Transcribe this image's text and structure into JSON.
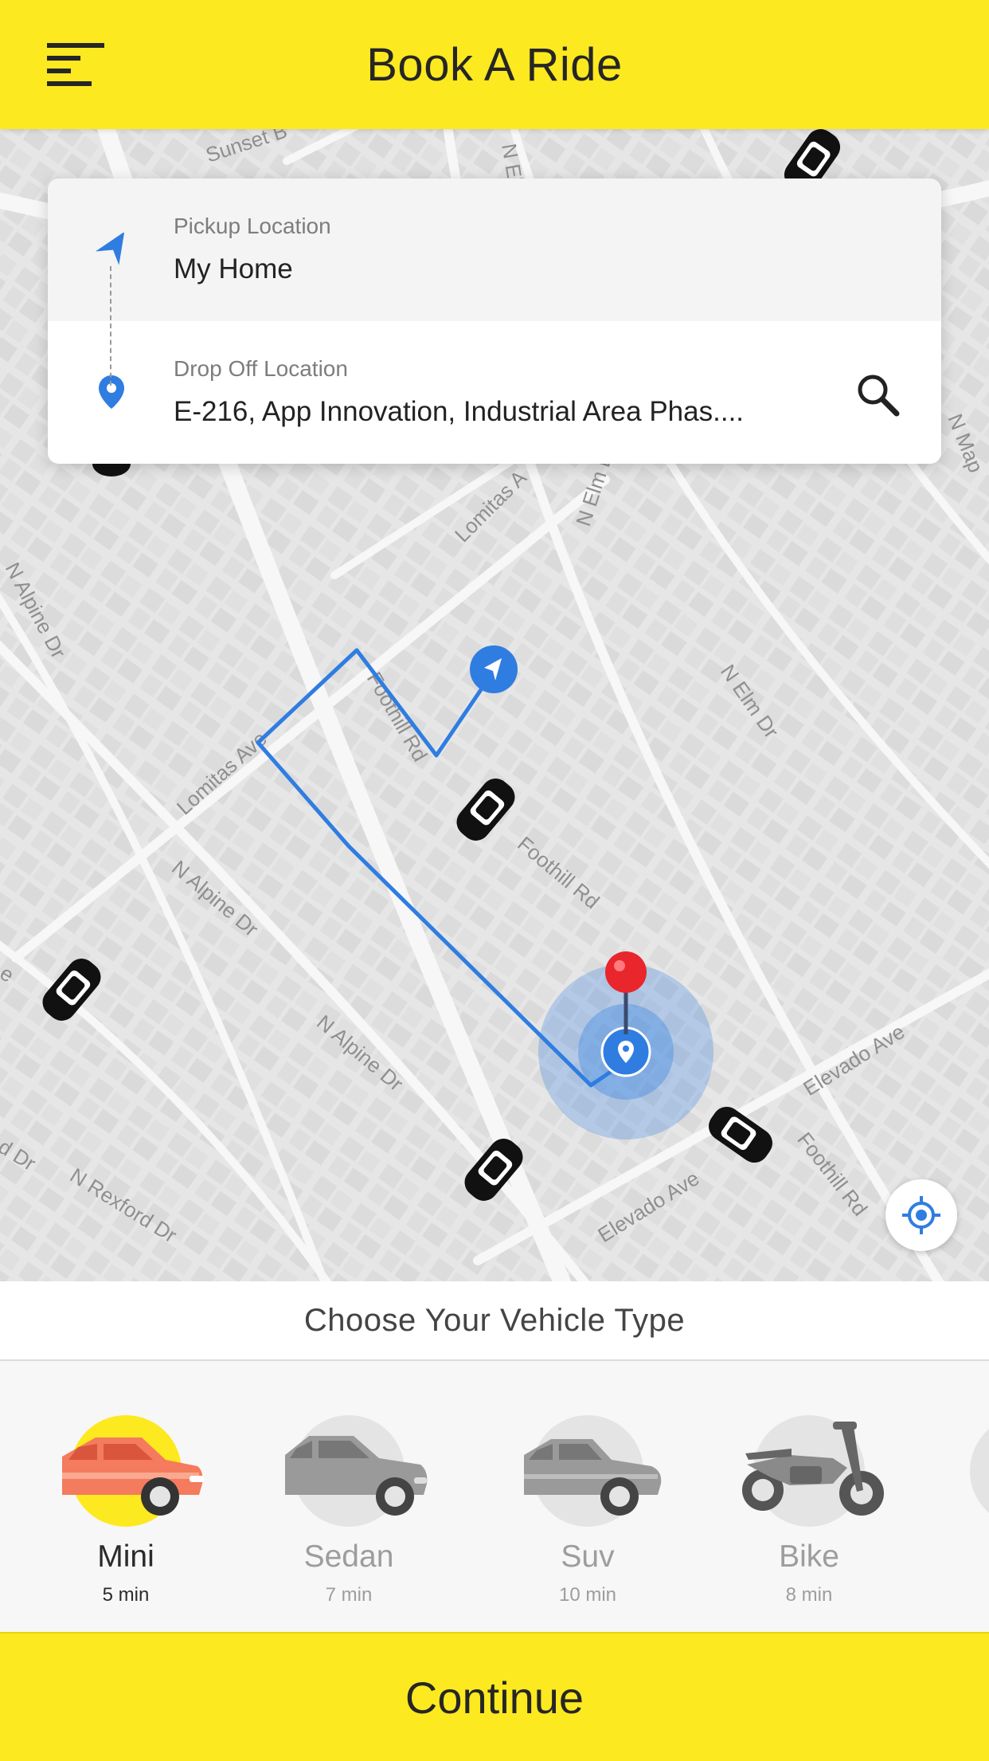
{
  "header": {
    "title": "Book A Ride",
    "menu_icon": "menu-icon"
  },
  "map": {
    "street_labels": [
      "Sunset B",
      "N Elm",
      "Lomitas A",
      "N Elm Dr",
      "N Map",
      "N Alpine Dr",
      "Lomitas Ave",
      "Foothill Rd",
      "N Elm Dr",
      "N Alpine Dr",
      "Foothill Rd",
      "N Alpine Dr",
      "Elevado Ave",
      "Elevado Ave",
      "Foothill Rd",
      "N Rexford Dr",
      "d Dr",
      "e"
    ],
    "route_color": "#2f7de1",
    "destination_pin_color": "#e8262c"
  },
  "location_card": {
    "pickup": {
      "label": "Pickup Location",
      "value": "My Home",
      "icon": "navigation-arrow-icon"
    },
    "dropoff": {
      "label": "Drop Off Location",
      "value": "E-216, App Innovation, Industrial Area Phas....",
      "icon": "location-pin-icon"
    },
    "search_icon": "search-icon"
  },
  "locate_icon": "crosshair-icon",
  "vehicle_section": {
    "title": "Choose Your Vehicle Type",
    "vehicles": [
      {
        "name": "Mini",
        "eta": "5 min",
        "selected": true,
        "icon": "mini-car-icon"
      },
      {
        "name": "Sedan",
        "eta": "7 min",
        "selected": false,
        "icon": "sedan-car-icon"
      },
      {
        "name": "Suv",
        "eta": "10 min",
        "selected": false,
        "icon": "suv-car-icon"
      },
      {
        "name": "Bike",
        "eta": "8 min",
        "selected": false,
        "icon": "bike-icon"
      }
    ]
  },
  "continue_label": "Continue",
  "colors": {
    "accent": "#fde91f",
    "blue": "#2f7de1"
  }
}
